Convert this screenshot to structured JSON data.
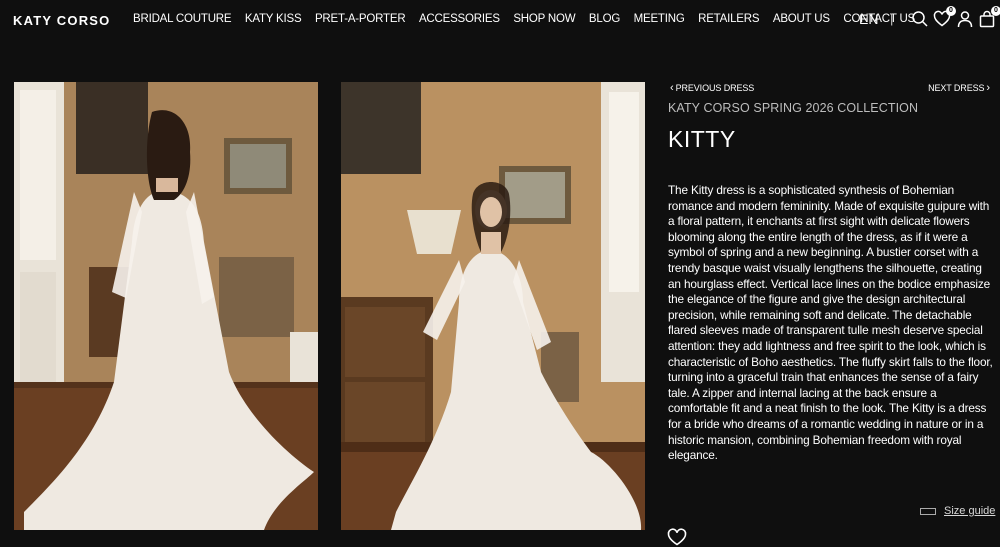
{
  "header": {
    "logo": "KATY CORSO",
    "nav": [
      {
        "label": "BRIDAL COUTURE"
      },
      {
        "label": "KATY KISS"
      },
      {
        "label": "PRET-A-PORTER"
      },
      {
        "label": "ACCESSORIES"
      },
      {
        "label": "SHOP NOW"
      },
      {
        "label": "BLOG"
      },
      {
        "label": "MEETING"
      },
      {
        "label": "RETAILERS"
      },
      {
        "label": "ABOUT US"
      },
      {
        "label": "CONTACT US"
      }
    ],
    "language": "EN",
    "separator": "|",
    "wishlist_count": "0",
    "cart_count": "0",
    "icons": [
      "search-icon",
      "heart-icon",
      "user-icon",
      "bag-icon"
    ]
  },
  "gallery": {
    "photos": [
      {
        "name": "dress-back-view"
      },
      {
        "name": "dress-front-view"
      }
    ]
  },
  "product": {
    "prev_label": "PREVIOUS DRESS",
    "next_label": "NEXT DRESS",
    "collection": "KATY CORSO SPRING 2026 COLLECTION",
    "name": "KITTY",
    "description": "The Kitty dress is a sophisticated synthesis of Bohemian romance and modern femininity. Made of exquisite guipure with a floral pattern, it enchants at first sight with delicate flowers blooming along the entire length of the dress, as if it were a symbol of spring and a new beginning. A bustier corset with a trendy basque waist visually lengthens the silhouette, creating an hourglass effect. Vertical lace lines on the bodice emphasize the elegance of the figure and give the design architectural precision, while remaining soft and delicate. The detachable flared sleeves made of transparent tulle mesh deserve special attention: they add lightness and free spirit to the look, which is characteristic of Boho aesthetics. The fluffy skirt falls to the floor, turning into a graceful train that enhances the sense of a fairy tale. A zipper and internal lacing at the back ensure a comfortable fit and a neat finish to the look. The Kitty is a dress for a bride who dreams of a romantic wedding in nature or in a historic mansion, combining Bohemian freedom with royal elegance.",
    "size_guide_label": "Size guide"
  },
  "colors": {
    "background": "#0f0f0f",
    "text": "#ffffff",
    "muted_text": "#bdbdbd",
    "wall": "#b08a5c",
    "floor": "#6a3f22",
    "dress": "#efe9e1"
  }
}
